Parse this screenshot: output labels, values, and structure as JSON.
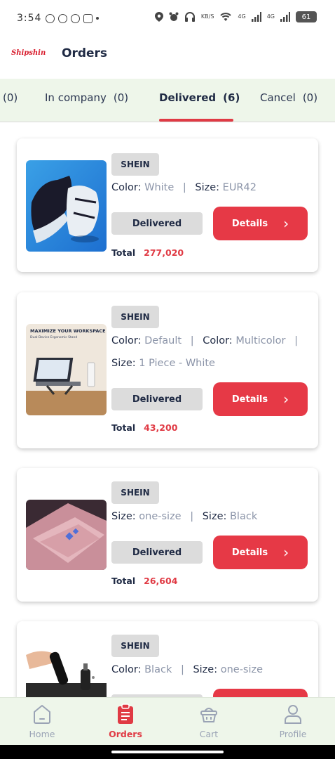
{
  "status_bar": {
    "time": "3:54",
    "net_speed": "KB/S",
    "net_a": "4G",
    "net_b": "4G",
    "battery": "61"
  },
  "header": {
    "logo_text": "Shipshin",
    "title": "Orders"
  },
  "tabs": [
    {
      "label": "",
      "count": "(0)"
    },
    {
      "label": "In company",
      "count": "(0)"
    },
    {
      "label": "Delivered",
      "count": "(6)"
    },
    {
      "label": "Cancel",
      "count": "(0)"
    }
  ],
  "orders": [
    {
      "store": "SHEIN",
      "attrs": [
        [
          {
            "k": "Color:",
            "v": "White"
          },
          {
            "k": "Size:",
            "v": "EUR42"
          }
        ]
      ],
      "status": "Delivered",
      "details_label": "Details",
      "total_label": "Total",
      "total_value": "277,020",
      "thumb_icon": "football-boots-image"
    },
    {
      "store": "SHEIN",
      "attrs": [
        [
          {
            "k": "Color:",
            "v": "Default"
          },
          {
            "k": "Color:",
            "v": "Multicolor"
          }
        ],
        [
          {
            "k": "Size:",
            "v": "1 Piece - White"
          }
        ]
      ],
      "banner_title": "MAXIMIZE YOUR WORKSPACE",
      "banner_sub": "Dual-Device Ergonomic Stand",
      "status": "Delivered",
      "details_label": "Details",
      "total_label": "Total",
      "total_value": "43,200",
      "thumb_icon": "laptop-stand-image"
    },
    {
      "store": "SHEIN",
      "attrs": [
        [
          {
            "k": "Size:",
            "v": "one-size"
          },
          {
            "k": "Size:",
            "v": "Black"
          }
        ]
      ],
      "status": "Delivered",
      "details_label": "Details",
      "total_label": "Total",
      "total_value": "26,604",
      "thumb_icon": "playing-cards-image"
    },
    {
      "store": "SHEIN",
      "attrs": [
        [
          {
            "k": "Color:",
            "v": "Black"
          },
          {
            "k": "Size:",
            "v": "one-size"
          }
        ]
      ],
      "thumb_icon": "nose-trimmer-image"
    }
  ],
  "bottom_nav": [
    {
      "label": "Home",
      "icon": "home-icon"
    },
    {
      "label": "Orders",
      "icon": "orders-clipboard-icon"
    },
    {
      "label": "Cart",
      "icon": "cart-basket-icon"
    },
    {
      "label": "Profile",
      "icon": "profile-icon"
    }
  ],
  "colors": {
    "accent": "#e63946",
    "tab_bg": "#eef6ea",
    "pill_bg": "#dcdcdc",
    "muted": "#8b94a8"
  }
}
